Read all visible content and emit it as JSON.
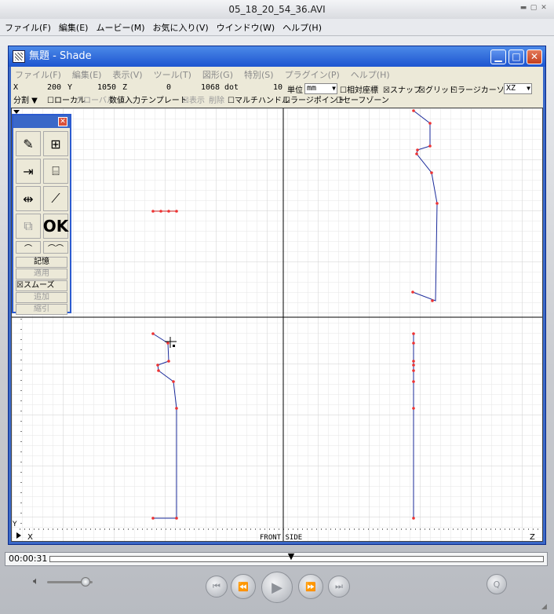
{
  "qt": {
    "title": "05_18_20_54_36.AVI",
    "menu": [
      "ファイル(F)",
      "編集(E)",
      "ムービー(M)",
      "お気に入り(V)",
      "ウインドウ(W)",
      "ヘルプ(H)"
    ],
    "time": "00:00:31",
    "progress_fraction": 0.49,
    "volume_fraction": 0.85
  },
  "shade": {
    "title": "無題 - Shade",
    "menu": [
      "ファイル(F)",
      "編集(E)",
      "表示(V)",
      "ツール(T)",
      "図形(G)",
      "特別(S)",
      "プラグイン(P)",
      "ヘルプ(H)"
    ],
    "coords": {
      "x_label": "X",
      "x_value": "200",
      "y_label": "Y",
      "y_value": "1050",
      "z_label": "Z",
      "z_value": "0",
      "dot_value": "1068",
      "dot_label": "dot",
      "step_value": "10",
      "unit_label": "単位",
      "unit_value": "mm",
      "relative": "☐相対座標",
      "snap": "☒スナップ",
      "grid": "☒グリッド",
      "large_cursor": "☐ラージカーソル",
      "plane": "XZ"
    },
    "opts": {
      "split": "分割",
      "local": "ローカル",
      "global": "グローバル",
      "numeric": "数値入力",
      "template": "テンプレート",
      "display_all": "☒表示",
      "delete": "削除",
      "multi_handle": "☐マルチハンドル",
      "large_point": "☐ラージポイント",
      "safe_zone": "☐セーフゾーン"
    },
    "palette": {
      "ok": "OK",
      "memory": "記憶",
      "apply": "適用",
      "smooth": "☒スムーズ",
      "add": "追加",
      "cancel": "縮引"
    },
    "view_labels": {
      "front_side": "FRONT SIDE",
      "x_axis": "X",
      "y_axis": "Y",
      "z_axis": "Z"
    }
  }
}
